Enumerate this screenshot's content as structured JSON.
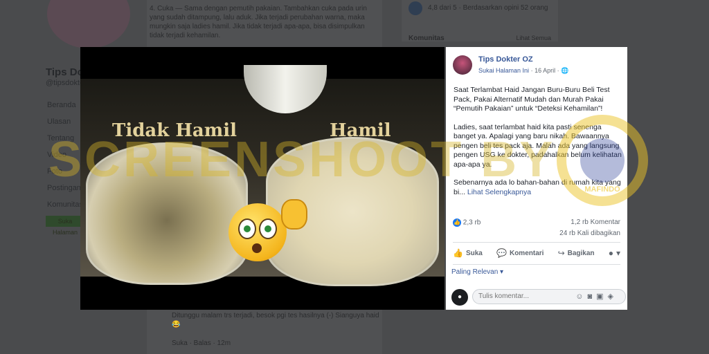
{
  "background": {
    "page_title": "Tips Dokter OZ",
    "page_handle": "@tipsdokteroz",
    "nav": [
      "Beranda",
      "Ulasan",
      "Tentang",
      "Video",
      "Foto",
      "Postingan",
      "Komunitas"
    ],
    "button": "Suka Halaman",
    "post_text": "4. Cuka — Sama dengan pemutih pakaian. Tambahkan cuka pada urin yang sudah ditampung, lalu aduk. Jika terjadi perubahan warna, maka mungkin saja ladies hamil. Jika tidak terjadi apa-apa, bisa disimpulkan tidak terjadi kehamilan.",
    "comment_text": "Ditunggu malam trs terjadi, besok pgi tes hasilnya (-) Sianguya haid 😂",
    "comment_meta": "Suka · Balas · 12m",
    "rating": "4,8 dari 5 · Berdasarkan opini 52 orang",
    "community": "Komunitas",
    "see_all": "Lihat Semua"
  },
  "photo": {
    "label_left": "Tidak Hamil",
    "label_right": "Hamil"
  },
  "watermark": "SCREENSHOOT BY",
  "mafindo_text": "MAFINDO",
  "post": {
    "author": "Tips Dokter OZ",
    "meta_link": "Sukai Halaman Ini",
    "date": "16 April",
    "paragraphs": [
      "Saat Terlambat Haid Jangan Buru-Buru Beli Test Pack, Pakai Alternatif Mudah dan Murah Pakai “Pemutih Pakaian” untuk “Deteksi Kehamilan”!",
      "Ladies, saat terlambat haid kita pasti senenga banget ya. Apalagi yang baru nikah. Bawaannya pengen beli tes pack aja. Malah ada yang langsung pengen USG ke dokter, padahalkan belum kelihatan apa-apa ya.",
      "Sebenarnya ada lo bahan-bahan di rumah kita yang bi..."
    ],
    "see_more": "Lihat Selengkapnya",
    "likes": "2,3 rb",
    "comments": "1,2 rb Komentar",
    "shares": "24 rb Kali dibagikan",
    "actions": {
      "like": "Suka",
      "comment": "Komentari",
      "share": "Bagikan"
    },
    "sort": "Paling Relevan ▾",
    "comment_placeholder": "Tulis komentar..."
  },
  "icons": {
    "globe": "globe-icon",
    "like": "thumbs-up-icon",
    "comment": "speech-bubble-icon",
    "share": "share-arrow-icon",
    "emoji": "smiley-icon",
    "camera": "camera-icon",
    "gif": "gif-icon",
    "sticker": "sticker-icon"
  },
  "colors": {
    "link": "#385898",
    "accent": "#1877f2",
    "watermark": "#d6b428"
  }
}
